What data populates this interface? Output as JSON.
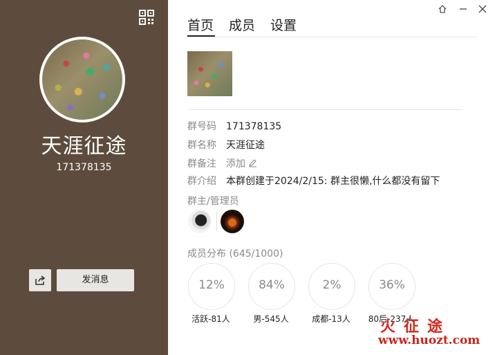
{
  "window": {
    "controls": [
      {
        "name": "pin-icon",
        "symbol": "⌂"
      },
      {
        "name": "minimize-icon",
        "symbol": "—"
      },
      {
        "name": "close-icon",
        "symbol": "✕"
      }
    ]
  },
  "profile": {
    "name": "天涯征途",
    "id": "171378135",
    "send_message_label": "发消息",
    "qr_icon": "qr-code-icon",
    "share_icon": "share-icon"
  },
  "tabs": [
    {
      "label": "首页",
      "active": true
    },
    {
      "label": "成员",
      "active": false
    },
    {
      "label": "设置",
      "active": false
    }
  ],
  "info": {
    "group_number_label": "群号码",
    "group_number": "171378135",
    "group_name_label": "群名称",
    "group_name": "天涯征途",
    "remark_label": "群备注",
    "remark_action": "添加",
    "intro_label": "群介绍",
    "intro": "本群创建于2024/2/15:  群主很懒,什么都没有留下",
    "admins_label": "群主/管理员"
  },
  "distribution": {
    "label": "成员分布 (645/1000)",
    "stats": [
      {
        "percent": "12%",
        "caption": "活跃-81人"
      },
      {
        "percent": "84%",
        "caption": "男-545人"
      },
      {
        "percent": "2%",
        "caption": "成都-13人"
      },
      {
        "percent": "36%",
        "caption": "80后-237人"
      }
    ]
  },
  "watermark": {
    "text": "火征途",
    "url": "www.huozt.com"
  },
  "colors": {
    "sidebar": "#5d4c3d",
    "accent_text": "#222222",
    "muted_text": "#8a8a8a",
    "watermark": "#d42a1f"
  }
}
